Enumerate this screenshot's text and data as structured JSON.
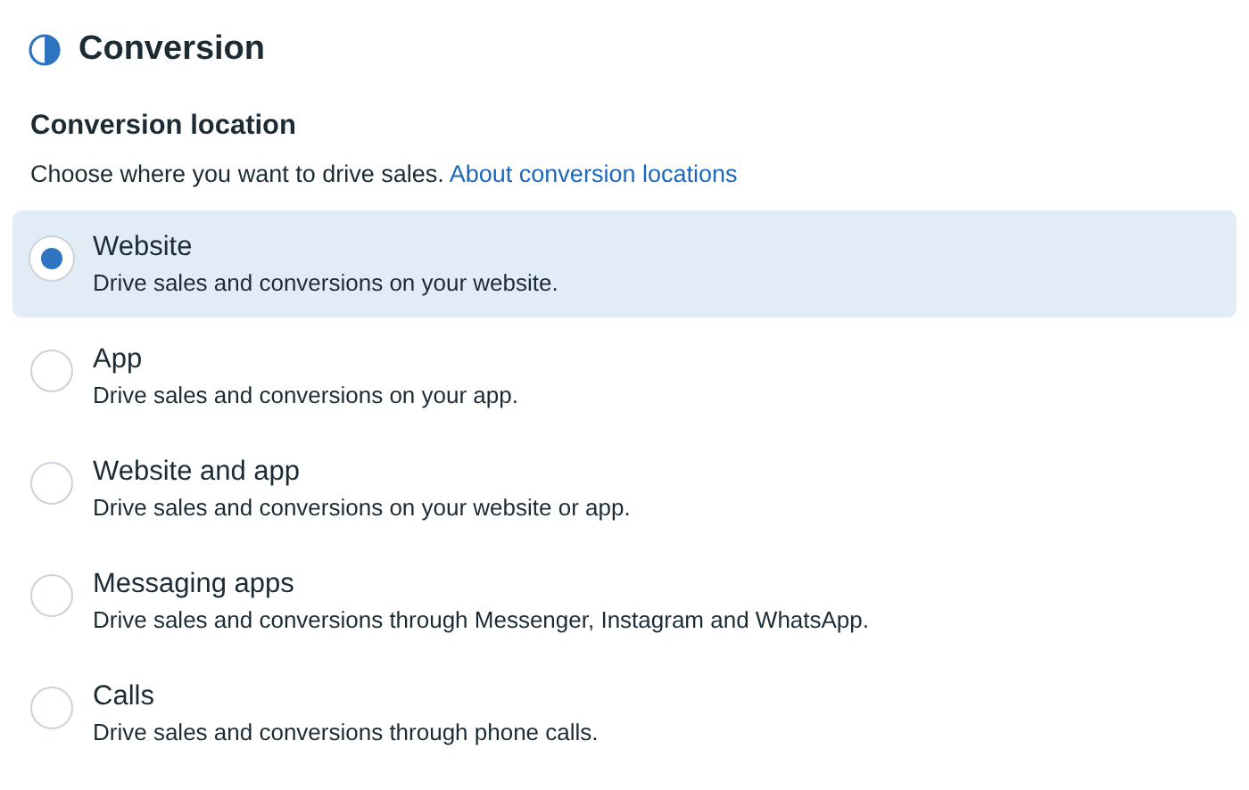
{
  "section": {
    "title": "Conversion"
  },
  "field": {
    "label": "Conversion location",
    "description": "Choose where you want to drive sales.",
    "link": "About conversion locations"
  },
  "options": [
    {
      "title": "Website",
      "description": "Drive sales and conversions on your website.",
      "selected": true
    },
    {
      "title": "App",
      "description": "Drive sales and conversions on your app.",
      "selected": false
    },
    {
      "title": "Website and app",
      "description": "Drive sales and conversions on your website or app.",
      "selected": false
    },
    {
      "title": "Messaging apps",
      "description": "Drive sales and conversions through Messenger, Instagram and WhatsApp.",
      "selected": false
    },
    {
      "title": "Calls",
      "description": "Drive sales and conversions through phone calls.",
      "selected": false
    }
  ]
}
